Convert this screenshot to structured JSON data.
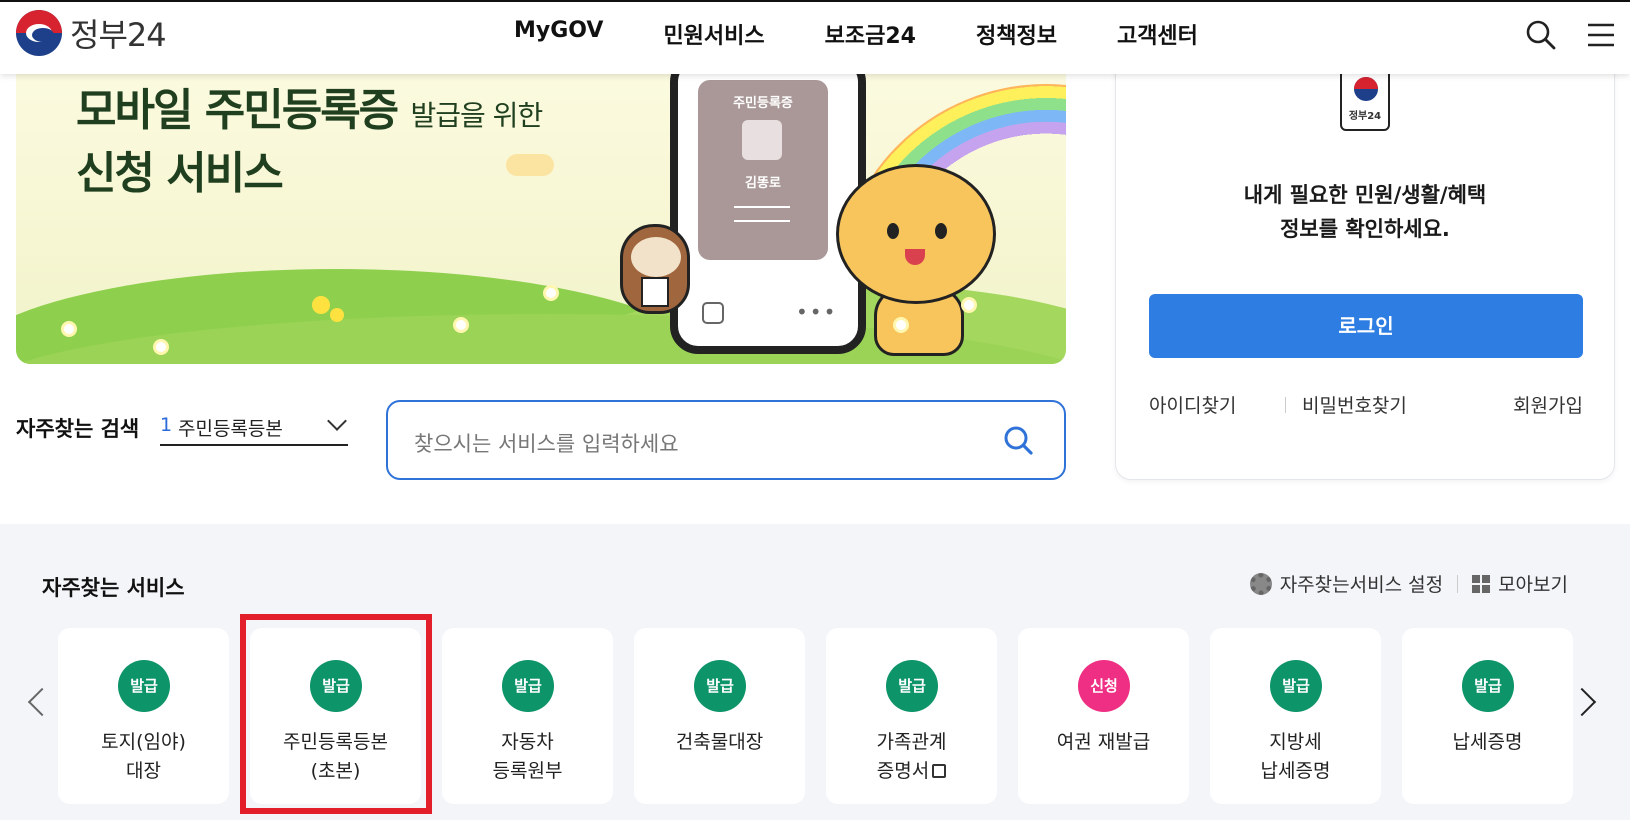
{
  "header": {
    "logo_text": "정부24",
    "nav": [
      "MyGOV",
      "민원서비스",
      "보조금24",
      "정책정보",
      "고객센터"
    ],
    "icons": [
      "search-icon",
      "menu-icon"
    ]
  },
  "banner": {
    "title_main": "모바일 주민등록증",
    "title_sub": "발급을 위한",
    "title_line2": "신청 서비스",
    "card_title": "주민등록증",
    "card_name": "김똥로"
  },
  "search": {
    "label": "자주찾는 검색",
    "selected_num": "1",
    "selected_text": "주민등록등본",
    "placeholder": "찾으시는 서비스를 입력하세요"
  },
  "login": {
    "logo_text": "정부24",
    "message_line1": "내게 필요한 민원/생활/혜택",
    "message_line2": "정보를 확인하세요.",
    "button": "로그인",
    "find_id": "아이디찾기",
    "find_pw": "비밀번호찾기",
    "signup": "회원가입"
  },
  "favorites": {
    "title": "자주찾는 서비스",
    "settings_label": "자주찾는서비스 설정",
    "view_all_label": "모아보기",
    "cards": [
      {
        "badge": "발급",
        "line1": "토지(임야)",
        "line2": "대장",
        "badge_color": "#0d9468"
      },
      {
        "badge": "발급",
        "line1": "주민등록등본",
        "line2": "(초본)",
        "badge_color": "#0d9468"
      },
      {
        "badge": "발급",
        "line1": "자동차",
        "line2": "등록원부",
        "badge_color": "#0d9468"
      },
      {
        "badge": "발급",
        "line1": "건축물대장",
        "line2": "",
        "badge_color": "#0d9468"
      },
      {
        "badge": "발급",
        "line1": "가족관계",
        "line2": "증명서",
        "badge_color": "#0d9468"
      },
      {
        "badge": "신청",
        "line1": "여권 재발급",
        "line2": "",
        "badge_color": "#ee2f83"
      },
      {
        "badge": "발급",
        "line1": "지방세",
        "line2": "납세증명",
        "badge_color": "#0d9468"
      },
      {
        "badge": "발급",
        "line1": "납세증명",
        "line2": "",
        "badge_color": "#0d9468"
      }
    ]
  },
  "colors": {
    "accent": "#2e7de3",
    "issue_badge": "#0d9468",
    "apply_badge": "#ee2f83",
    "highlight": "#e21f2a"
  }
}
